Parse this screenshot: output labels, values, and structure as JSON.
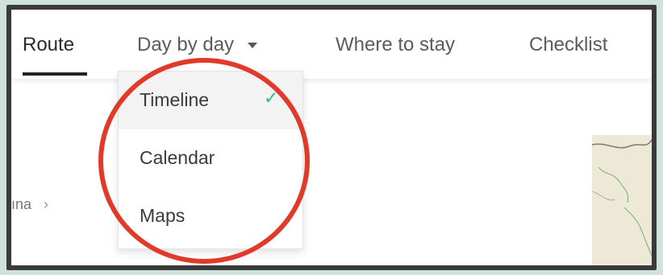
{
  "nav": {
    "tabs": [
      {
        "label": "Route",
        "active": true
      },
      {
        "label": "Day by day",
        "has_dropdown": true
      },
      {
        "label": "Where to stay"
      },
      {
        "label": "Checklist"
      }
    ]
  },
  "dropdown": {
    "items": [
      {
        "label": "Timeline",
        "selected": true
      },
      {
        "label": "Calendar"
      },
      {
        "label": "Maps"
      }
    ],
    "check_icon": "check-icon"
  },
  "breadcrumb": {
    "text": "ına",
    "chevron": "›"
  },
  "colors": {
    "annotation": "#e23a2a",
    "check": "#35b39a",
    "background": "#cfe3dc"
  }
}
